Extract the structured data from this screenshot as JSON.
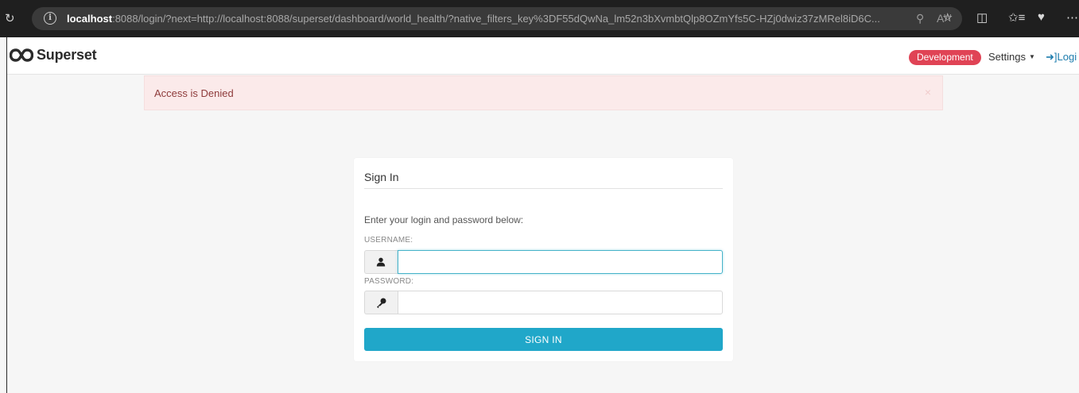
{
  "browser": {
    "url_host": "localhost",
    "url_rest": ":8088/login/?next=http://localhost:8088/superset/dashboard/world_health/?native_filters_key%3DF55dQwNa_lm52n3bXvmbtQlp8OZmYfs5C-HZj0dwiz37zMRel8iD6C..."
  },
  "app": {
    "name": "Superset",
    "environment_tag": "Development",
    "environment_color": "#e04355",
    "settings_label": "Settings",
    "login_label": "Logi",
    "accent_color": "#20a7c9"
  },
  "alert": {
    "message": "Access is Denied",
    "close_glyph": "×"
  },
  "login_form": {
    "title": "Sign In",
    "subtitle": "Enter your login and password below:",
    "username_label": "USERNAME:",
    "username_value": "",
    "password_label": "PASSWORD:",
    "password_value": "",
    "submit_label": "SIGN IN"
  }
}
